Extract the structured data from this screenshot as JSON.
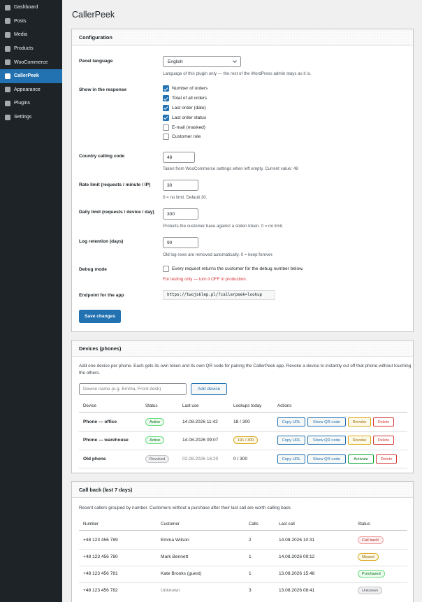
{
  "sidebar": {
    "items": [
      {
        "label": "Dashboard",
        "icon": "dashboard-icon"
      },
      {
        "label": "Posts",
        "icon": "posts-icon"
      },
      {
        "label": "Media",
        "icon": "media-icon"
      },
      {
        "label": "Products",
        "icon": "products-icon"
      },
      {
        "label": "WooCommerce",
        "icon": "woocommerce-icon"
      },
      {
        "label": "CallerPeek",
        "icon": "callerpeek-icon",
        "active": true
      },
      {
        "label": "Appearance",
        "icon": "appearance-icon"
      },
      {
        "label": "Plugins",
        "icon": "plugins-icon"
      },
      {
        "label": "Settings",
        "icon": "settings-icon"
      }
    ]
  },
  "page": {
    "title": "CallerPeek"
  },
  "config": {
    "title": "Configuration",
    "language": {
      "label": "Panel language",
      "value": "English",
      "desc": "Language of this plugin only — the rest of the WordPress admin stays as it is."
    },
    "response": {
      "label": "Show in the response",
      "options": [
        {
          "label": "Number of orders",
          "checked": true
        },
        {
          "label": "Total of all orders",
          "checked": true
        },
        {
          "label": "Last order (date)",
          "checked": true
        },
        {
          "label": "Last order status",
          "checked": true
        },
        {
          "label": "E-mail (masked)",
          "checked": false
        },
        {
          "label": "Customer role",
          "checked": false
        }
      ]
    },
    "country": {
      "label": "Country calling code",
      "value": "48",
      "desc": "Taken from WooCommerce settings when left empty. Current value: 48"
    },
    "rate": {
      "label": "Rate limit (requests / minute / IP)",
      "value": "30",
      "desc": "0 = no limit. Default 30."
    },
    "daily": {
      "label": "Daily limit (requests / device / day)",
      "value": "300",
      "desc": "Protects the customer base against a stolen token. 0 = no limit."
    },
    "log": {
      "label": "Log retention (days)",
      "value": "90",
      "desc": "Old log rows are removed automatically. 0 = keep forever."
    },
    "debug": {
      "label": "Debug mode",
      "option": "Every request returns the customer for the debug number below.",
      "checked": false,
      "warning": "For testing only — turn it OFF in production."
    },
    "endpoint": {
      "label": "Endpoint for the app",
      "value": "https://twojsklep.pl/?callerpeek=lookup"
    },
    "save_label": "Save changes"
  },
  "devices": {
    "title": "Devices (phones)",
    "intro": "Add one device per phone. Each gets its own token and its own QR code for pairing the CallerPeek app. Revoke a device to instantly cut off that phone without touching the others.",
    "name_placeholder": "Device name (e.g. Emma, Front desk)",
    "add_label": "Add device",
    "headers": {
      "device": "Device",
      "status": "Status",
      "last_use": "Last use",
      "lookups": "Lookups today",
      "actions": "Actions"
    },
    "rows": [
      {
        "name": "Phone — office",
        "status": "Active",
        "last_use": "14.08.2026 11:42",
        "lookups": "18 / 300",
        "copy": "Copy URL",
        "qr": "Show QR code",
        "toggle": "Revoke",
        "delete": "Delete"
      },
      {
        "name": "Phone — warehouse",
        "status": "Active",
        "last_use": "14.08.2026 09:07",
        "lookups": "191 / 300",
        "copy": "Copy URL",
        "qr": "Show QR code",
        "toggle": "Revoke",
        "delete": "Delete"
      },
      {
        "name": "Old phone",
        "status": "Revoked",
        "last_use": "02.08.2026 16:20",
        "lookups": "0 / 300",
        "copy": "Copy URL",
        "qr": "Show QR code",
        "toggle": "Activate",
        "delete": "Delete"
      }
    ]
  },
  "callback": {
    "title": "Call back (last 7 days)",
    "intro": "Recent callers grouped by number. Customers without a purchase after their last call are worth calling back.",
    "headers": {
      "number": "Number",
      "customer": "Customer",
      "calls": "Calls",
      "last_call": "Last call",
      "status": "Status"
    },
    "rows": [
      {
        "number": "+48 123 456 789",
        "customer": "Emma Wilson",
        "calls": "2",
        "last_call": "14.08.2026 10:31",
        "status": "Call back!"
      },
      {
        "number": "+48 123 456 780",
        "customer": "Mark Bennett",
        "calls": "1",
        "last_call": "14.08.2026 09:12",
        "status": "Missed"
      },
      {
        "number": "+48 123 456 781",
        "customer": "Kate Brooks (guest)",
        "calls": "1",
        "last_call": "13.08.2026 15:48",
        "status": "Purchased"
      },
      {
        "number": "+48 123 456 782",
        "customer": "Unknown",
        "calls": "3",
        "last_call": "13.08.2026 08:41",
        "status": "Unknown"
      }
    ]
  }
}
